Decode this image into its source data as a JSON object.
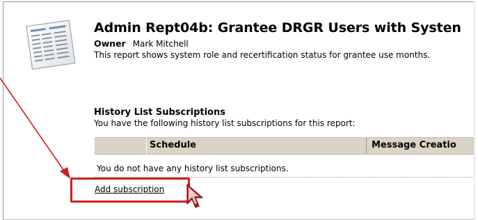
{
  "report": {
    "title": "Admin Rept04b: Grantee DRGR Users with Systen",
    "owner_label": "Owner",
    "owner_name": "Mark Mitchell",
    "description": "This report shows system role and recertification status for grantee use months."
  },
  "history": {
    "section_title": "History List Subscriptions",
    "intro": "You have the following history list subscriptions for this report:",
    "columns": [
      "",
      "Schedule",
      "Message Creatio"
    ],
    "empty_message": "You do not have any history list subscriptions.",
    "add_link": "Add subscription"
  },
  "annotation": {
    "highlight_color": "#cc1f1f",
    "arrow_color": "#cc1f1f"
  },
  "icons": {
    "report": "report-document-icon",
    "cursor": "mouse-pointer-icon"
  }
}
